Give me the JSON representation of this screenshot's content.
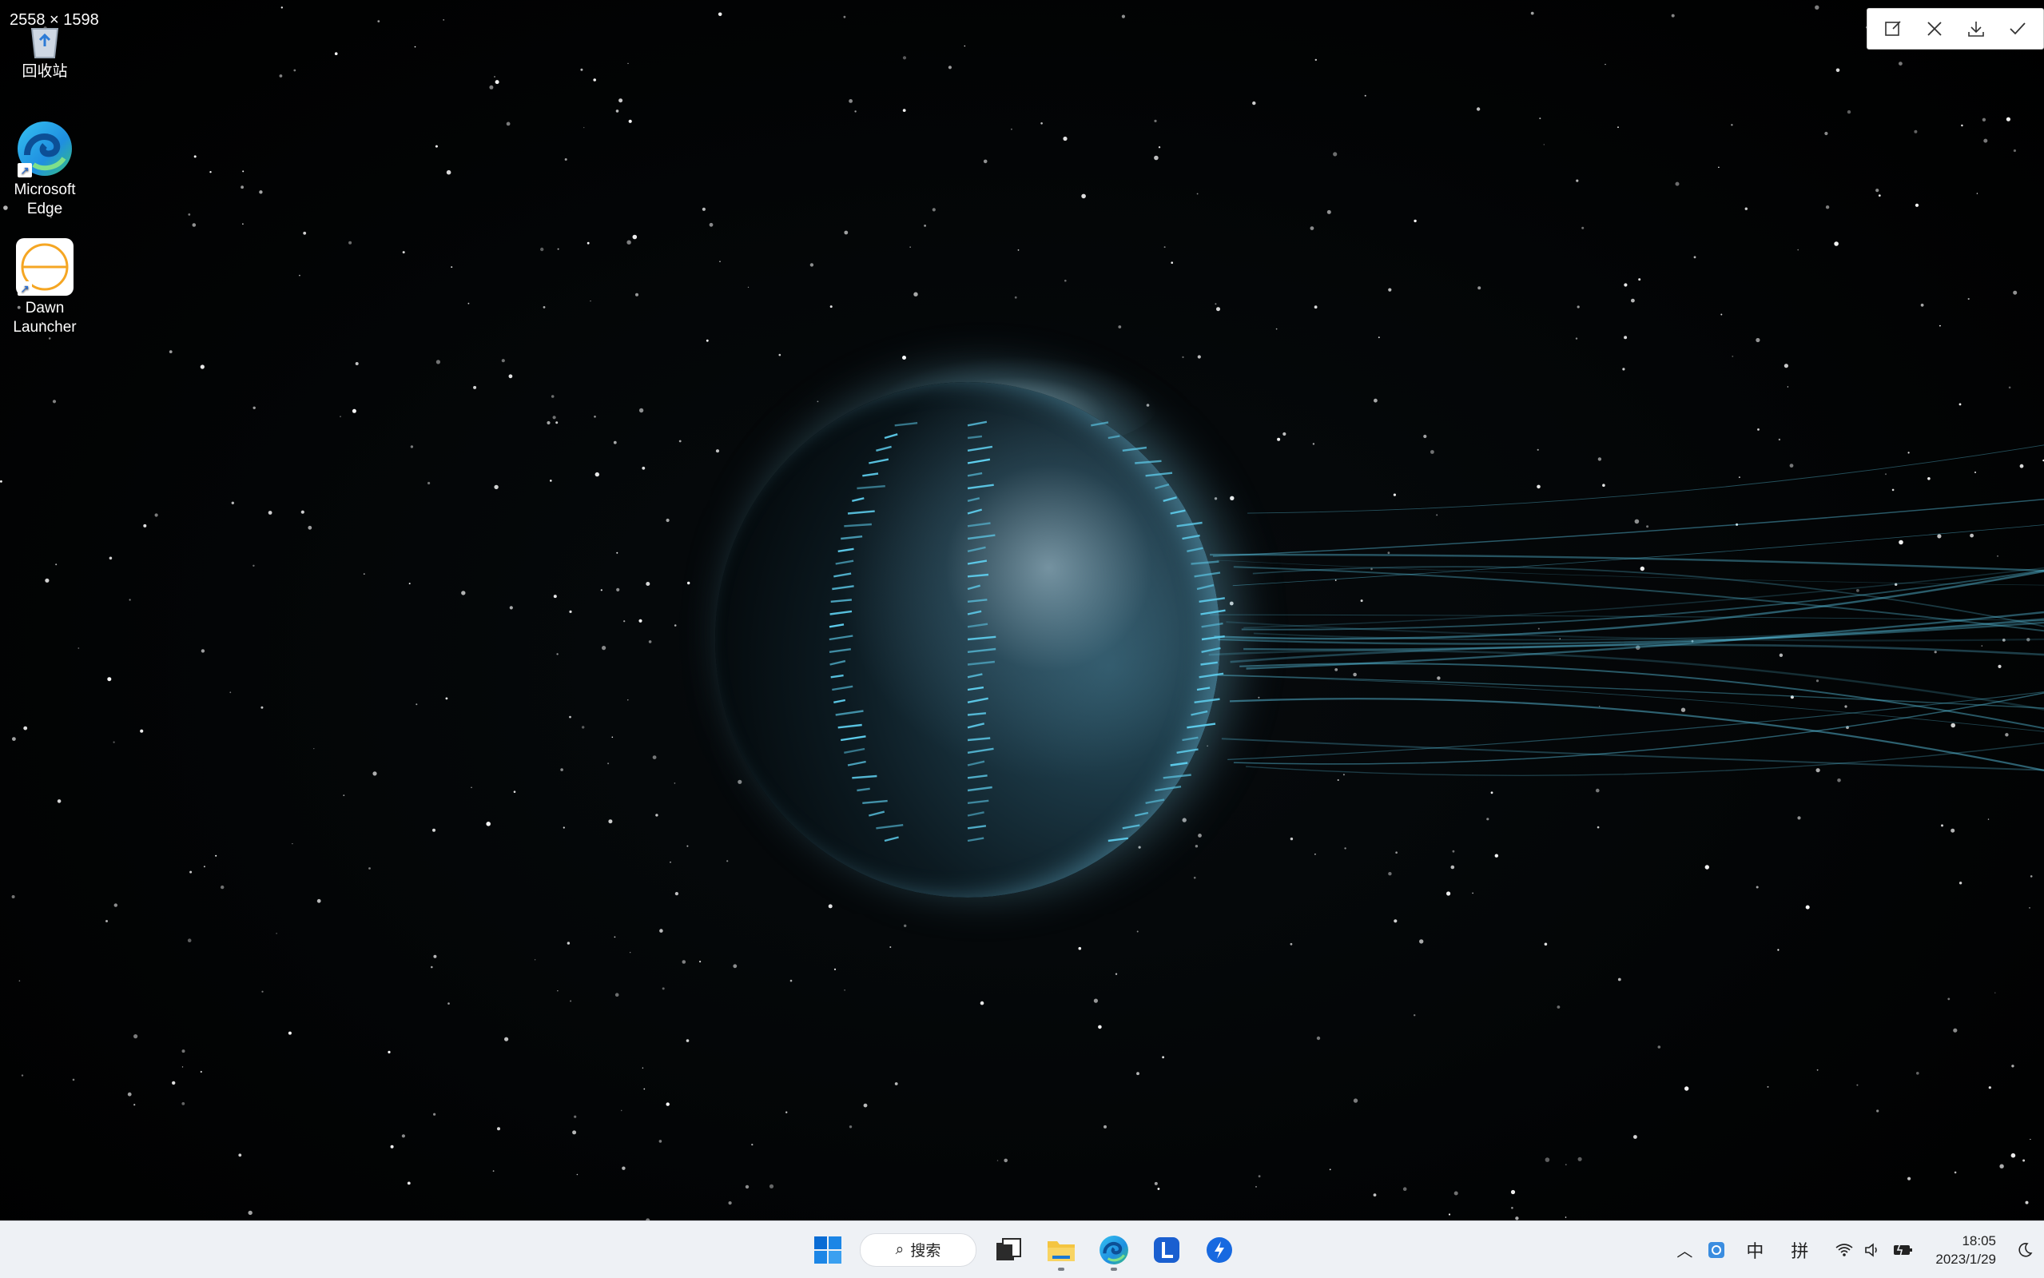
{
  "screenshot_label": "2558 × 1598",
  "desktop": {
    "icons": [
      {
        "label": "回收站",
        "icon": "recycle-bin-icon"
      },
      {
        "label": "Microsoft Edge",
        "icon": "edge-icon"
      },
      {
        "label": "Dawn Launcher",
        "icon": "dawn-launcher-icon"
      }
    ]
  },
  "snip_toolbar": {
    "buttons": [
      "open-in-editor",
      "close",
      "download",
      "confirm"
    ]
  },
  "taskbar": {
    "search_label": "搜索",
    "apps": [
      "start",
      "search",
      "task-view",
      "file-explorer",
      "edge",
      "app-l",
      "app-blue"
    ],
    "tray": {
      "ime_mode": "中",
      "ime_pinyin": "拼",
      "time": "18:05",
      "date": "2023/1/29"
    }
  },
  "colors": {
    "taskbar_bg": "#eef1f5",
    "planet_accent": "#5fd0f0",
    "windows_blue": "#0a6cd4"
  }
}
